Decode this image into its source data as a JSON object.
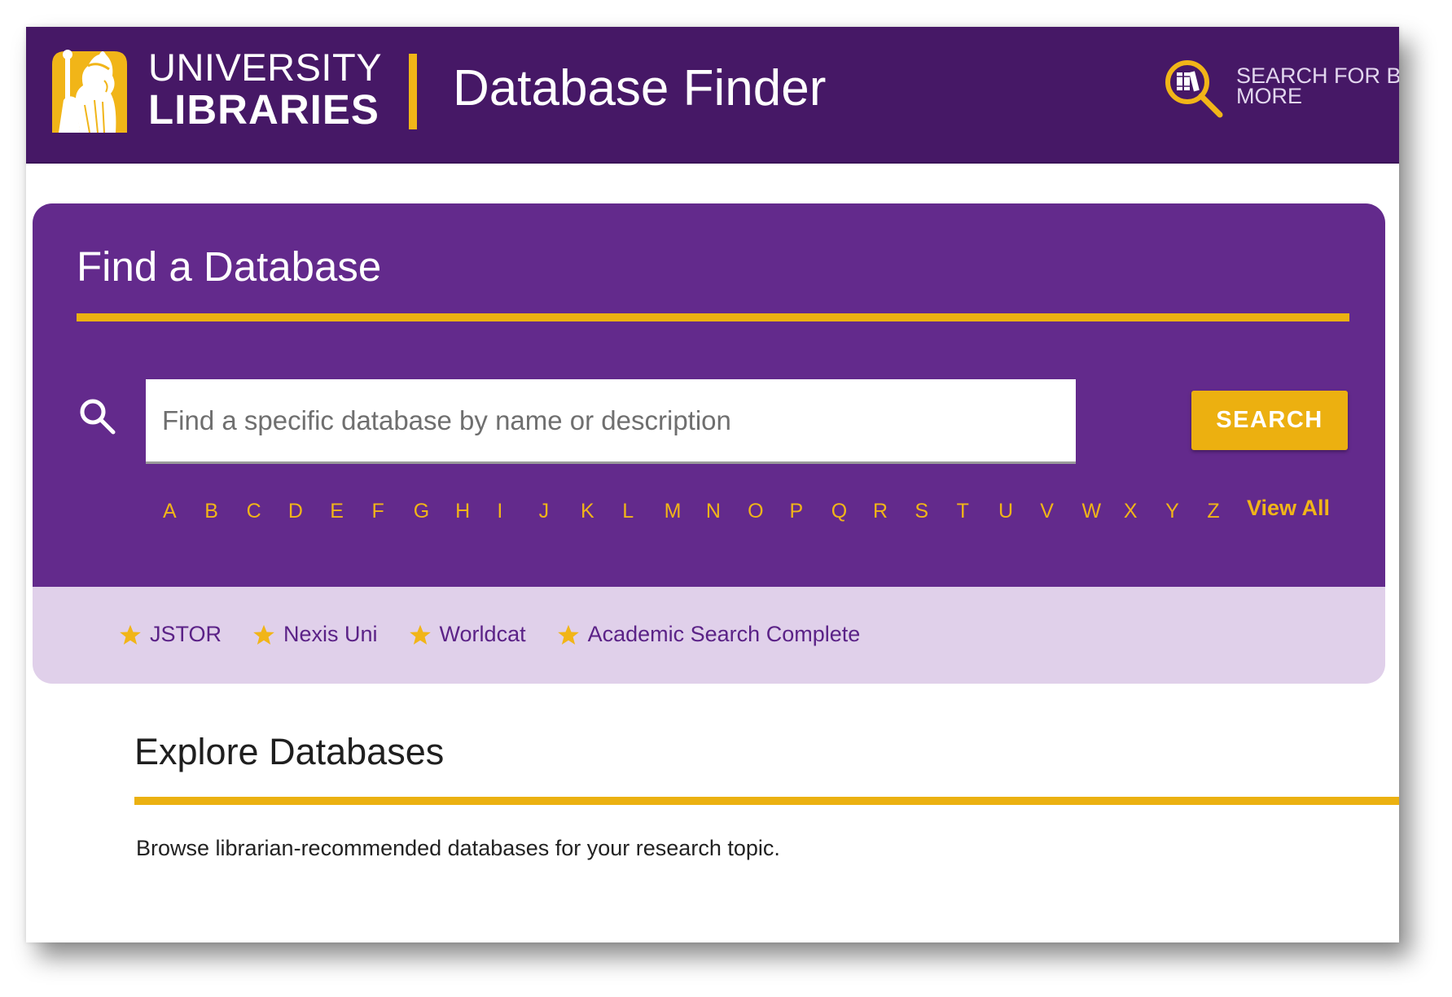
{
  "header": {
    "logo_line1": "UNIVERSITY",
    "logo_line2": "LIBRARIES",
    "app_title": "Database Finder",
    "catalog_link_line1": "SEARCH FOR BO",
    "catalog_link_line2": "MORE",
    "colors": {
      "background": "#461866",
      "accent": "#f1b518"
    }
  },
  "find": {
    "title": "Find a Database",
    "search_placeholder": "Find a specific database by name or description",
    "search_value": "",
    "search_button": "SEARCH",
    "letters": [
      "A",
      "B",
      "C",
      "D",
      "E",
      "F",
      "G",
      "H",
      "I",
      "J",
      "K",
      "L",
      "M",
      "N",
      "O",
      "P",
      "Q",
      "R",
      "S",
      "T",
      "U",
      "V",
      "W",
      "X",
      "Y",
      "Z"
    ],
    "view_all": "View All",
    "colors": {
      "panel": "#632a8c",
      "accent": "#ecb010"
    }
  },
  "favorites": [
    {
      "icon": "star-icon",
      "label": "JSTOR"
    },
    {
      "icon": "star-icon",
      "label": "Nexis Uni"
    },
    {
      "icon": "star-icon",
      "label": "Worldcat"
    },
    {
      "icon": "star-icon",
      "label": "Academic Search Complete"
    }
  ],
  "explore": {
    "title": "Explore Databases",
    "description": "Browse librarian-recommended databases for your research topic."
  }
}
